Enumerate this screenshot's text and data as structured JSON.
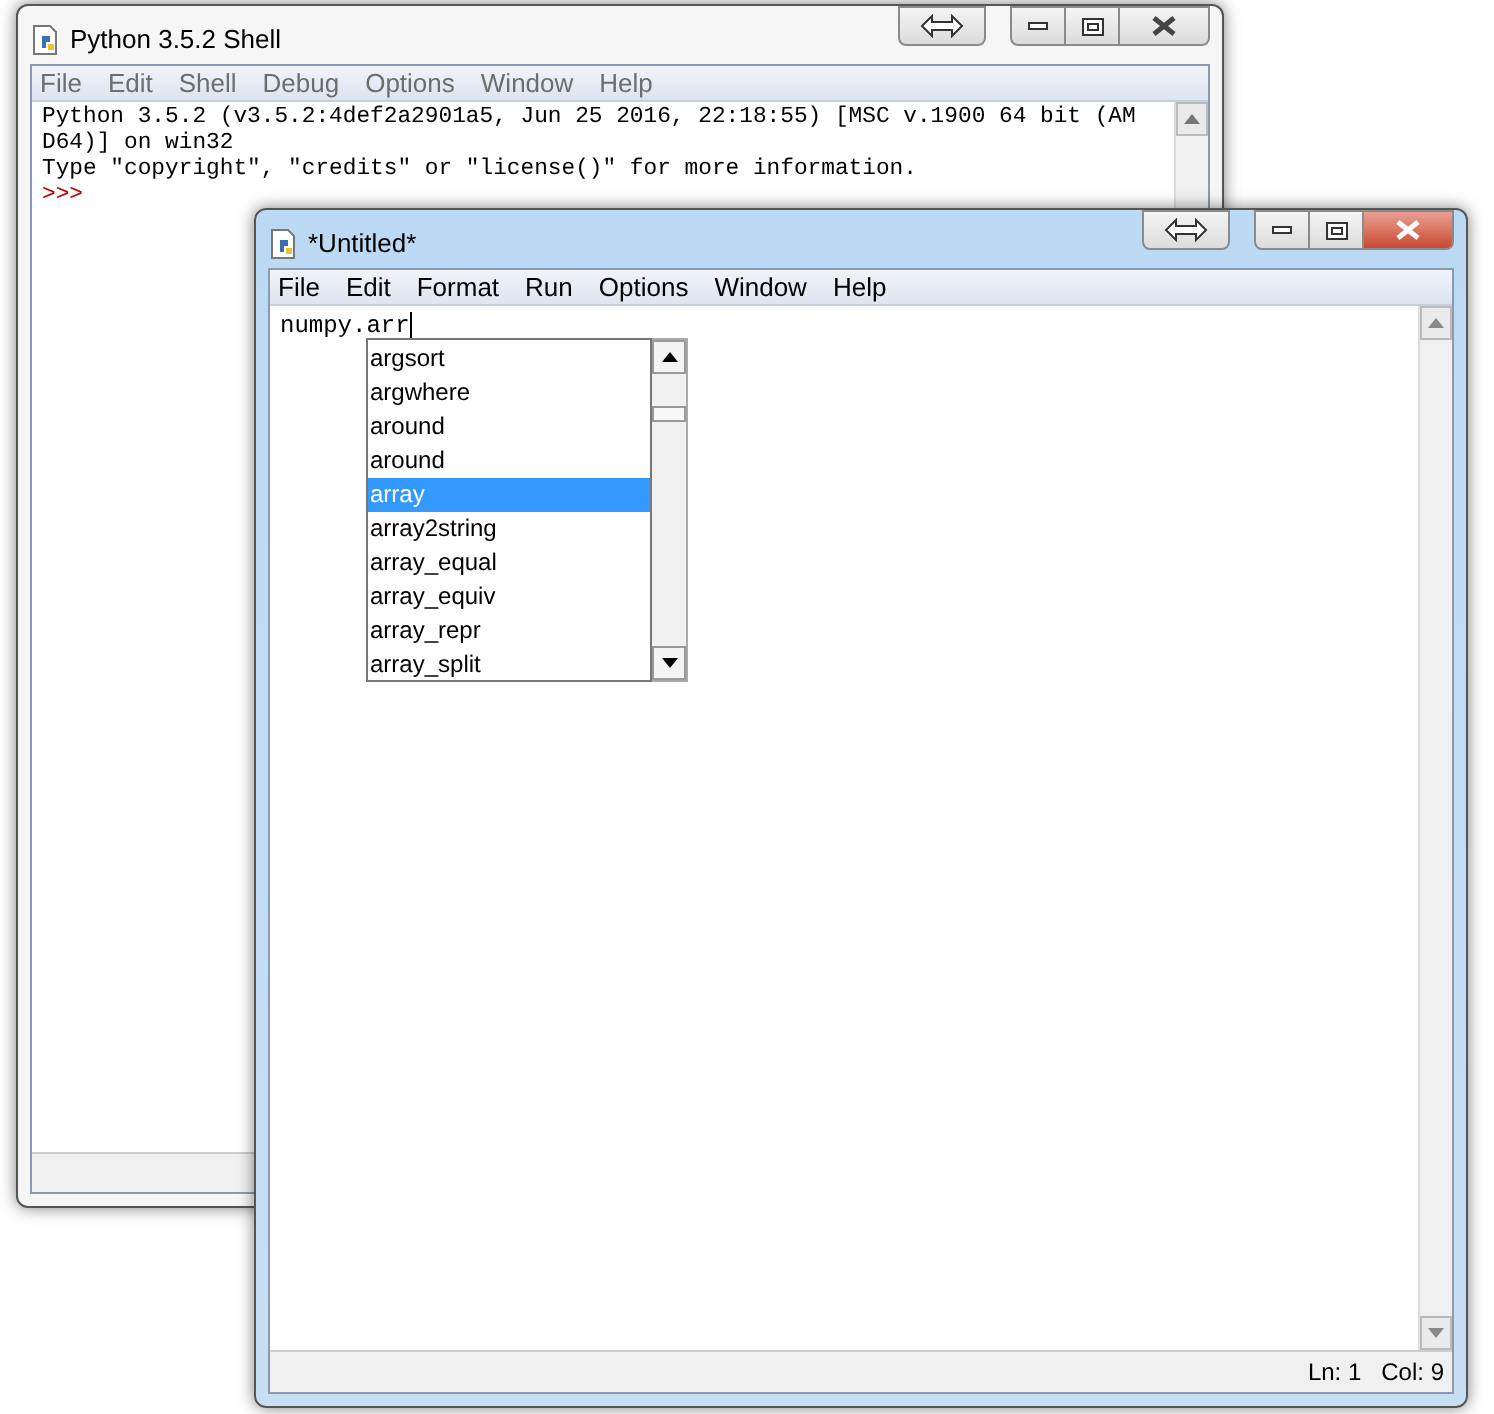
{
  "shell_window": {
    "title": "Python 3.5.2 Shell",
    "active": false,
    "menu": [
      "File",
      "Edit",
      "Shell",
      "Debug",
      "Options",
      "Window",
      "Help"
    ],
    "lines": [
      "Python 3.5.2 (v3.5.2:4def2a2901a5, Jun 25 2016, 22:18:55) [MSC v.1900 64 bit (AM",
      "D64)] on win32",
      "Type \"copyright\", \"credits\" or \"license()\" for more information."
    ],
    "prompt": ">>>"
  },
  "editor_window": {
    "title": "*Untitled*",
    "active": true,
    "menu": [
      "File",
      "Edit",
      "Format",
      "Run",
      "Options",
      "Window",
      "Help"
    ],
    "text": "numpy.arr",
    "autocomplete": [
      {
        "label": "argsort",
        "selected": false
      },
      {
        "label": "argwhere",
        "selected": false
      },
      {
        "label": "around",
        "selected": false
      },
      {
        "label": "around",
        "selected": false
      },
      {
        "label": "array",
        "selected": true
      },
      {
        "label": "array2string",
        "selected": false
      },
      {
        "label": "array_equal",
        "selected": false
      },
      {
        "label": "array_equiv",
        "selected": false
      },
      {
        "label": "array_repr",
        "selected": false
      },
      {
        "label": "array_split",
        "selected": false
      }
    ],
    "status": {
      "line": "Ln: 1",
      "col": "Col: 9"
    }
  }
}
